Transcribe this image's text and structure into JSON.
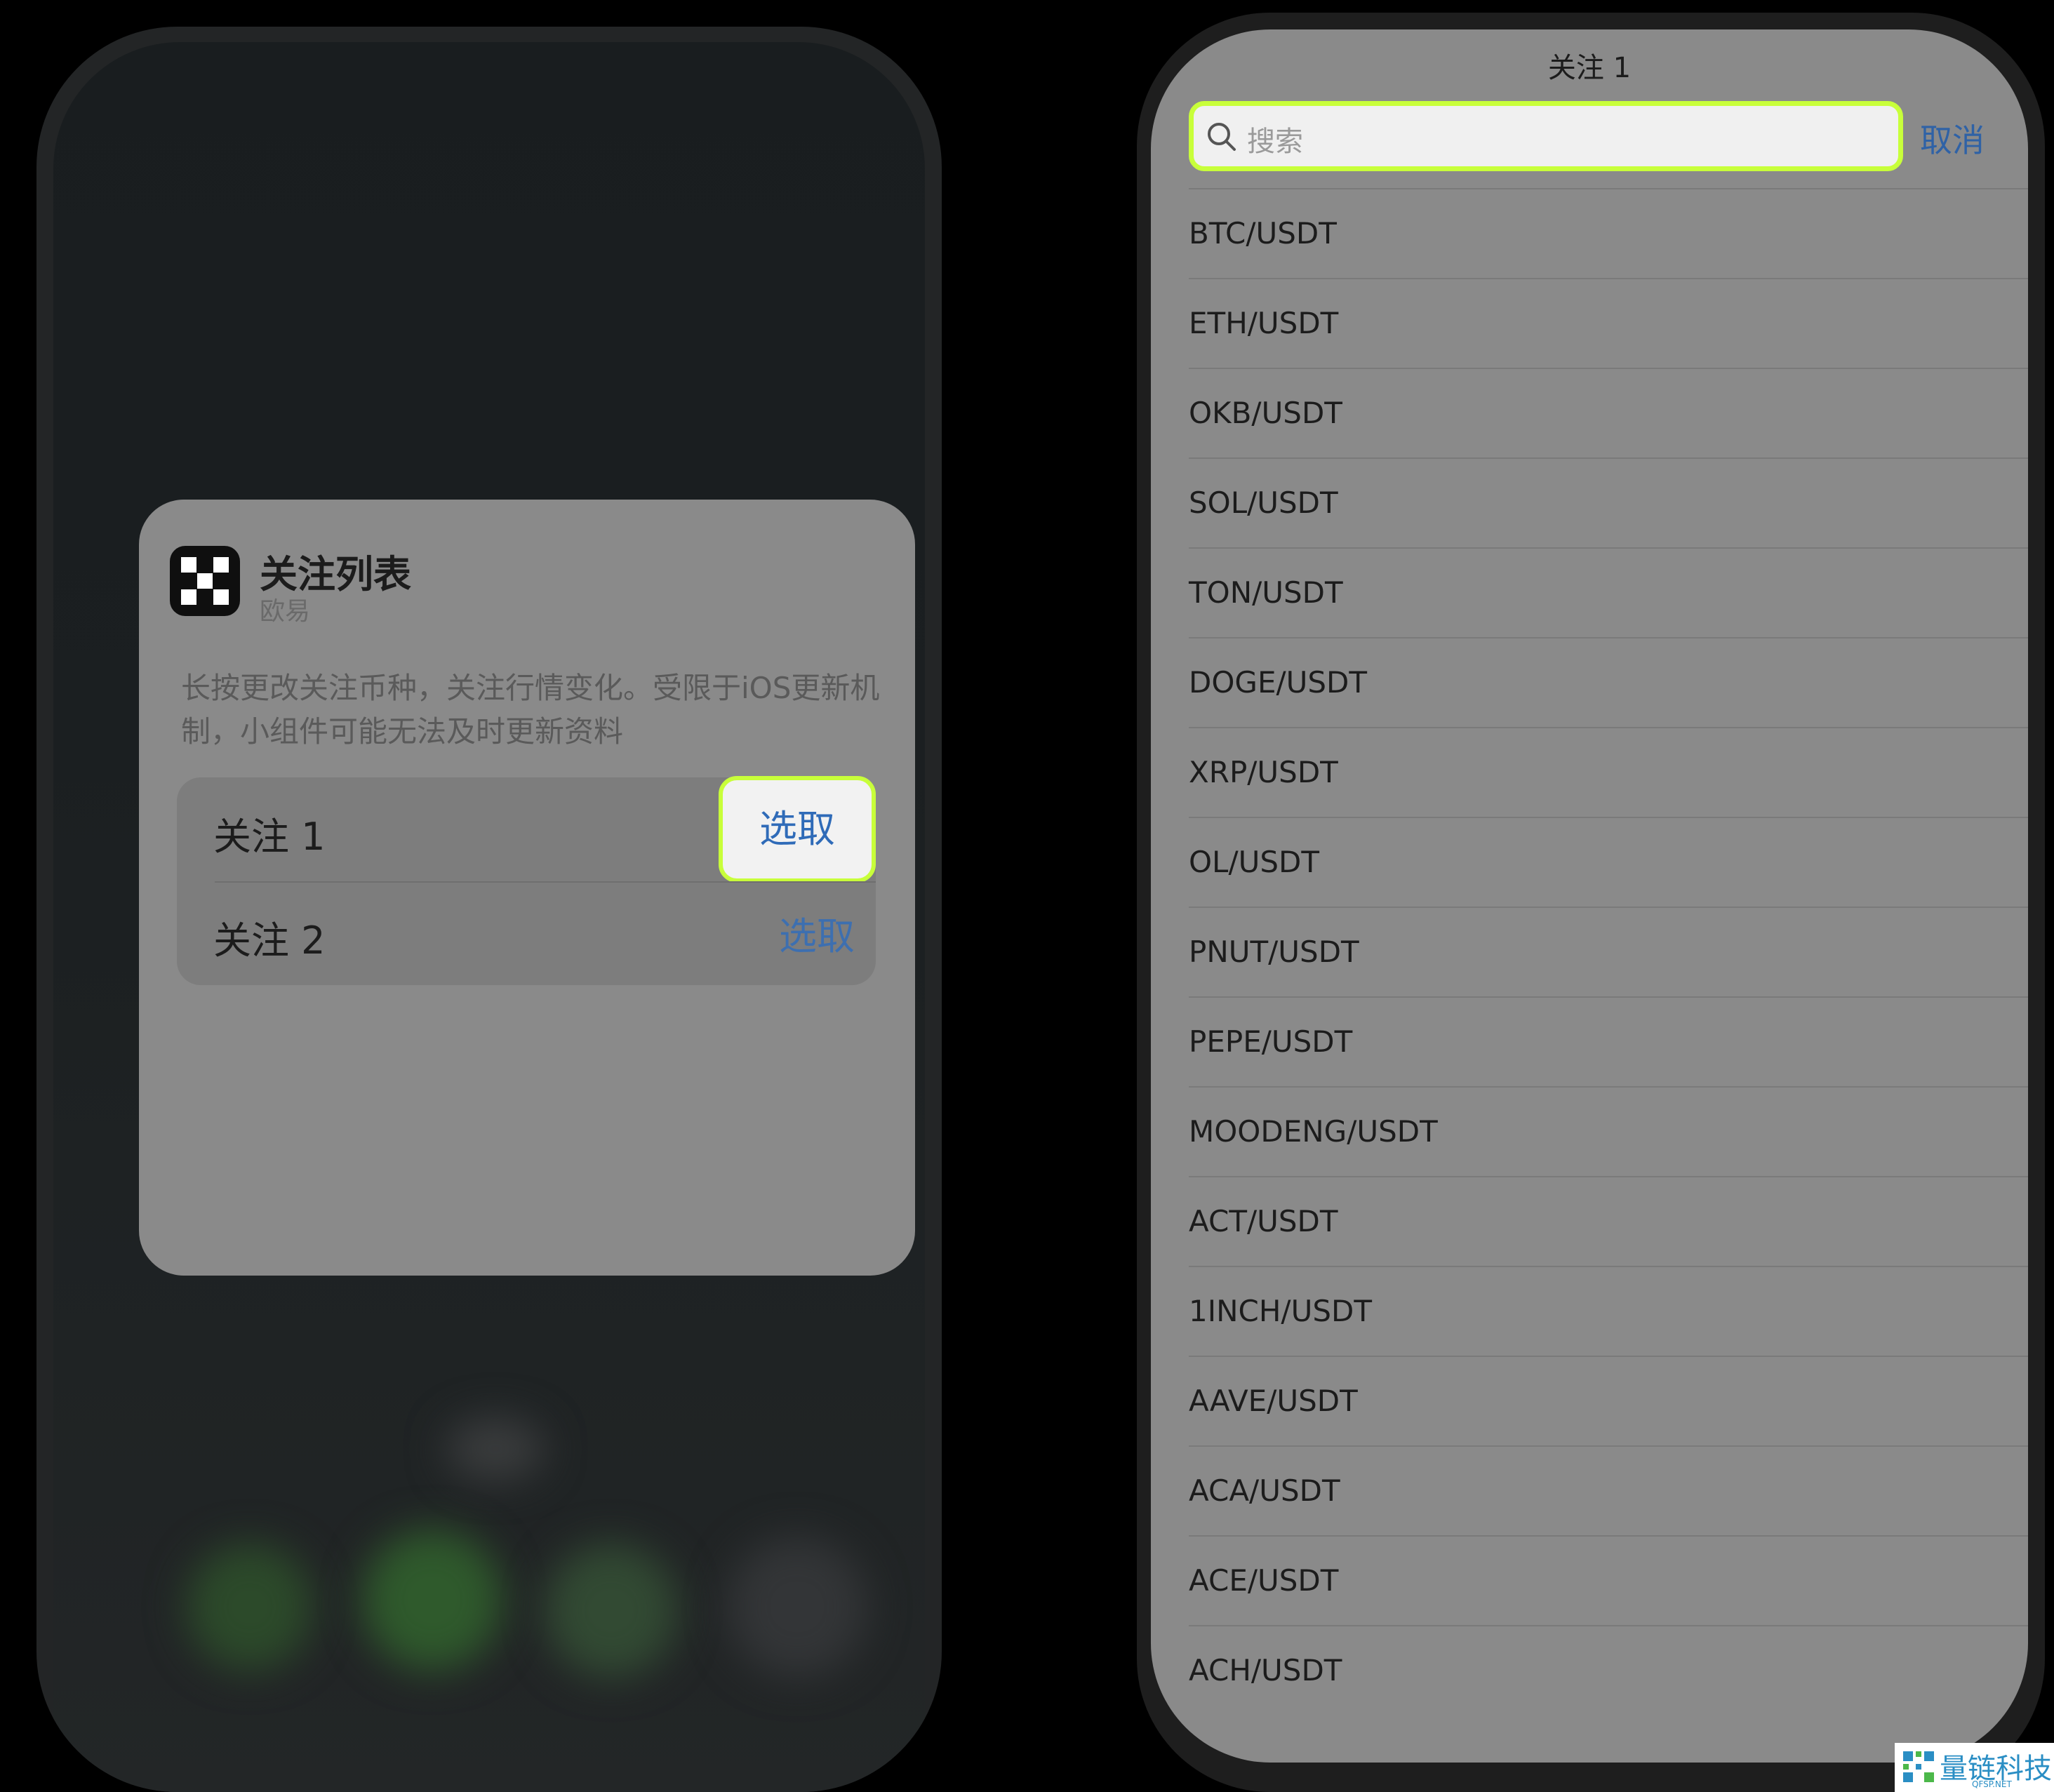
{
  "left_widget": {
    "title": "关注列表",
    "subtitle": "欧易",
    "description": "长按更改关注币种，关注行情变化。受限于iOS更新机制，小组件可能无法及时更新资料",
    "options": [
      {
        "label": "关注 1",
        "action": "选取",
        "highlighted": true
      },
      {
        "label": "关注 2",
        "action": "选取",
        "highlighted": false
      }
    ]
  },
  "right_screen": {
    "nav_title": "关注 1",
    "search": {
      "placeholder": "搜索"
    },
    "cancel_label": "取消",
    "coins": [
      "BTC/USDT",
      "ETH/USDT",
      "OKB/USDT",
      "SOL/USDT",
      "TON/USDT",
      "DOGE/USDT",
      "XRP/USDT",
      "OL/USDT",
      "PNUT/USDT",
      "PEPE/USDT",
      "MOODENG/USDT",
      "ACT/USDT",
      "1INCH/USDT",
      "AAVE/USDT",
      "ACA/USDT",
      "ACE/USDT",
      "ACH/USDT"
    ]
  },
  "watermark": {
    "text": "量链科技",
    "sub": "QFSP.NET"
  },
  "colors": {
    "highlight": "#c8ff3a",
    "link": "#2f62a6"
  }
}
